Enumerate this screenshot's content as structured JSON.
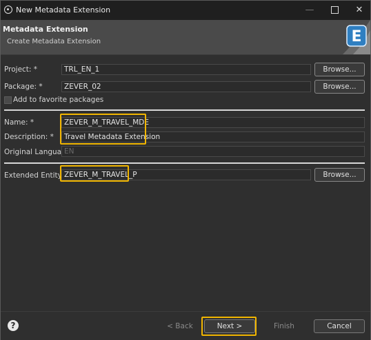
{
  "window": {
    "title": "New Metadata Extension"
  },
  "header": {
    "title": "Metadata Extension",
    "subtitle": "Create Metadata Extension",
    "logo_letter": "E"
  },
  "form": {
    "project_label": "Project: *",
    "project_value": "TRL_EN_1",
    "package_label": "Package: *",
    "package_value": "ZEVER_02",
    "browse_label": "Browse...",
    "favorite_label": "Add to favorite packages",
    "name_label": "Name: *",
    "name_value": "ZEVER_M_TRAVEL_MDE",
    "description_label": "Description: *",
    "description_value": "Travel Metadata Extension",
    "original_language_label": "Original Language:",
    "original_language_value": "EN",
    "extended_entity_label": "Extended Entity:",
    "extended_entity_value": "ZEVER_M_TRAVEL_P"
  },
  "footer": {
    "back_label": "< Back",
    "next_label": "Next >",
    "finish_label": "Finish",
    "cancel_label": "Cancel"
  },
  "colors": {
    "highlight": "#f2b600",
    "background": "#2f2f2f"
  }
}
